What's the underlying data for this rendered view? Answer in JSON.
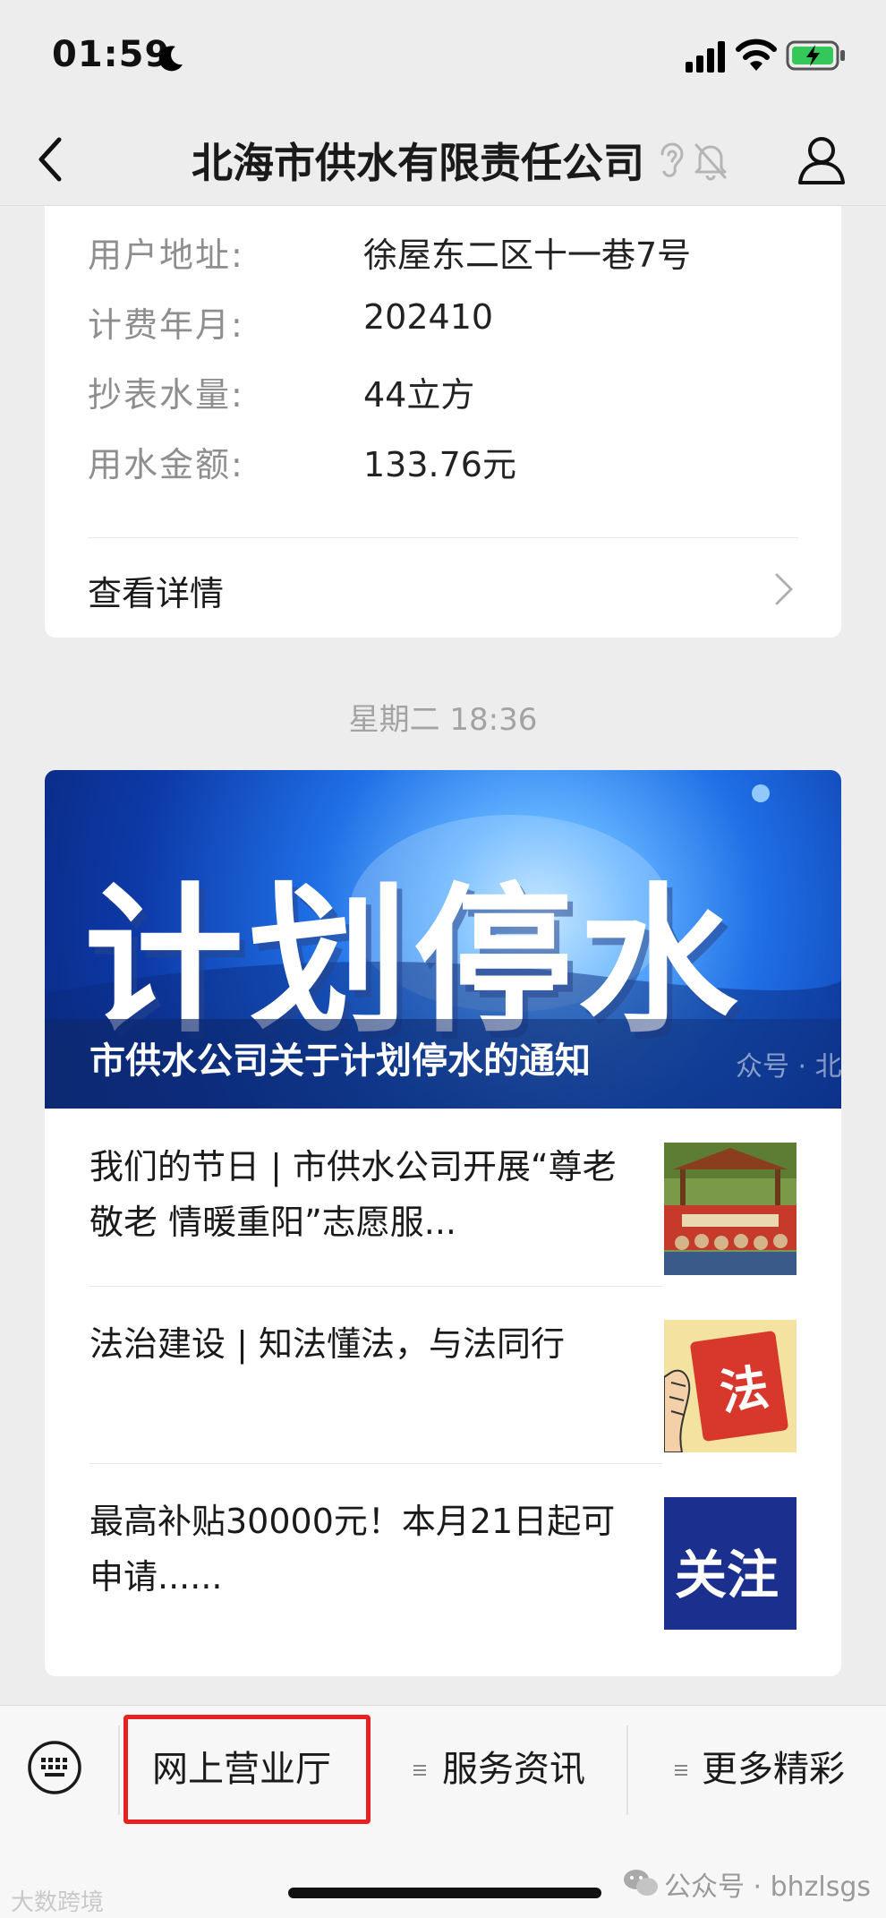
{
  "status_bar": {
    "time": "01:59"
  },
  "nav": {
    "title": "北海市供水有限责任公司"
  },
  "bill": {
    "rows": [
      {
        "label": "用户地址:",
        "value": "徐屋东二区十一巷7号"
      },
      {
        "label": "计费年月:",
        "value": "202410"
      },
      {
        "label": "抄表水量:",
        "value": "44立方"
      },
      {
        "label": "用水金额:",
        "value": "133.76元"
      }
    ],
    "detail_link": "查看详情"
  },
  "timestamp": "星期二 18:36",
  "banner": {
    "headline": "计划停水",
    "caption": "市供水公司关于计划停水的通知",
    "watermark": "众号 · 北海"
  },
  "articles": [
    {
      "title": "我们的节日 | 市供水公司开展“尊老敬老 情暖重阳”志愿服...",
      "thumb": "group-photo"
    },
    {
      "title": "法治建设 | 知法懂法，与法同行",
      "thumb": "law-book",
      "thumb_text": "法"
    },
    {
      "title": "最高补贴30000元！本月21日起可申请......",
      "thumb": "attention",
      "thumb_text": "关注"
    }
  ],
  "menu": {
    "items": [
      {
        "label": "网上营业厅"
      },
      {
        "label": "服务资讯"
      },
      {
        "label": "更多精彩"
      }
    ]
  },
  "footer": {
    "watermark_left": "大数跨境",
    "watermark_right": "公众号 · bhzlsgs"
  },
  "colors": {
    "highlight": "#e8201f",
    "banner_blue": "#1f6fe6",
    "attention_bg": "#1b2f8f"
  }
}
